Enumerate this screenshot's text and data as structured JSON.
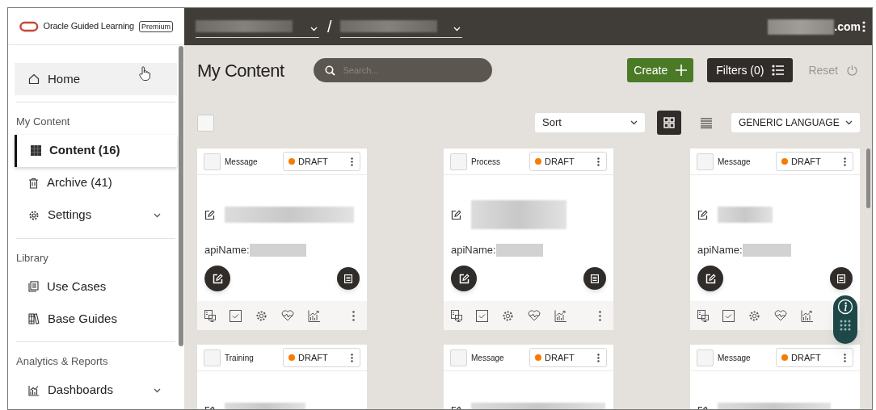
{
  "app": {
    "name": "Oracle Guided Learning",
    "badge": "Premium"
  },
  "top_bar": {
    "selectors": [
      {
        "kind": "dropdown"
      },
      {
        "kind": "dropdown"
      }
    ],
    "separator": "/",
    "account_suffix": ".com"
  },
  "sidebar": {
    "sections": [
      {
        "items": [
          {
            "label": "Home",
            "selected": false,
            "hovered": true,
            "expandable": false
          }
        ]
      },
      {
        "title": "My Content",
        "items": [
          {
            "label": "Content (16)",
            "selected": true,
            "hovered": false,
            "expandable": false
          },
          {
            "label": "Archive (41)",
            "selected": false,
            "hovered": false,
            "expandable": false
          },
          {
            "label": "Settings",
            "selected": false,
            "hovered": false,
            "expandable": true
          }
        ]
      },
      {
        "title": "Library",
        "items": [
          {
            "label": "Use Cases",
            "selected": false,
            "hovered": false,
            "expandable": false
          },
          {
            "label": "Base Guides",
            "selected": false,
            "hovered": false,
            "expandable": false
          }
        ]
      },
      {
        "title": "Analytics & Reports",
        "items": [
          {
            "label": "Dashboards",
            "selected": false,
            "hovered": false,
            "expandable": true
          }
        ]
      }
    ]
  },
  "page_title": "My Content",
  "search": {
    "placeholder": "Search..."
  },
  "actions": [
    {
      "kind": "create",
      "label": "Create",
      "disabled": false
    },
    {
      "kind": "filters",
      "label": "Filters (0)",
      "disabled": false
    },
    {
      "kind": "reset",
      "label": "Reset",
      "disabled": true
    }
  ],
  "toolbar": {
    "select_all_checked": false,
    "sort": "Sort",
    "view_modes": [
      {
        "kind": "grid",
        "selected": true
      },
      {
        "kind": "list",
        "selected": false
      }
    ],
    "language": "GENERIC LANGUAGE"
  },
  "cards": [
    {
      "type": "Message",
      "status": "DRAFT",
      "color": "#f57c00",
      "checked": false,
      "api_label": "apiName:"
    },
    {
      "type": "Process",
      "status": "DRAFT",
      "color": "#f57c00",
      "checked": false,
      "api_label": "apiName:"
    },
    {
      "type": "Message",
      "status": "DRAFT",
      "color": "#f57c00",
      "checked": false,
      "api_label": "apiName:"
    },
    {
      "type": "Training",
      "status": "DRAFT",
      "color": "#f57c00",
      "checked": false
    },
    {
      "type": "Message",
      "status": "DRAFT",
      "color": "#f57c00",
      "checked": false
    },
    {
      "type": "Message",
      "status": "DRAFT",
      "color": "#f57c00",
      "checked": false
    }
  ]
}
